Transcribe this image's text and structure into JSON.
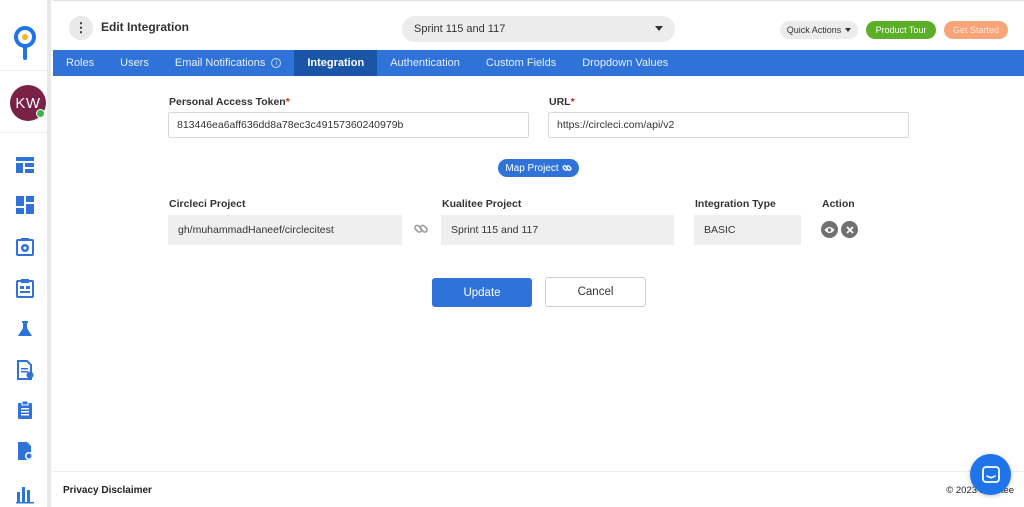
{
  "header": {
    "title": "Edit Integration",
    "sprint_selector": "Sprint 115 and 117",
    "quick_actions": "Quick Actions",
    "product_tour": "Product Tour",
    "get_started": "Get Started"
  },
  "user": {
    "initials": "KW"
  },
  "tabs": [
    {
      "label": "Roles"
    },
    {
      "label": "Users"
    },
    {
      "label": "Email Notifications"
    },
    {
      "label": "Integration",
      "active": true
    },
    {
      "label": "Authentication"
    },
    {
      "label": "Custom Fields"
    },
    {
      "label": "Dropdown Values"
    }
  ],
  "form": {
    "token_label": "Personal Access Token",
    "token_value": "813446ea6aff636dd8a78ec3c49157360240979b",
    "url_label": "URL",
    "url_value": "https://circleci.com/api/v2",
    "required_mark": "*",
    "map_project": "Map Project",
    "mapping_headers": {
      "source": "Circleci Project",
      "target": "Kualitee Project",
      "type": "Integration Type",
      "action": "Action"
    },
    "mapping": {
      "source": "gh/muhammadHaneef/circlecitest",
      "target": "Sprint 115 and 117",
      "type": "BASIC"
    },
    "update": "Update",
    "cancel": "Cancel"
  },
  "footer": {
    "privacy": "Privacy Disclaimer",
    "copyright": "© 2023 Kualitee"
  },
  "colors": {
    "primary": "#2f73d9",
    "active_tab": "#1b55a8",
    "tour": "#5aaf26",
    "get_started": "#f7a578",
    "avatar": "#7a2148"
  },
  "icons": {
    "logo": "kualitee-logo-icon",
    "sidebar": [
      "dashboard-icon",
      "widgets-icon",
      "settings-icon",
      "test-plan-icon",
      "flask-icon",
      "document-icon",
      "clipboard-icon",
      "report-icon",
      "bar-chart-icon"
    ]
  }
}
